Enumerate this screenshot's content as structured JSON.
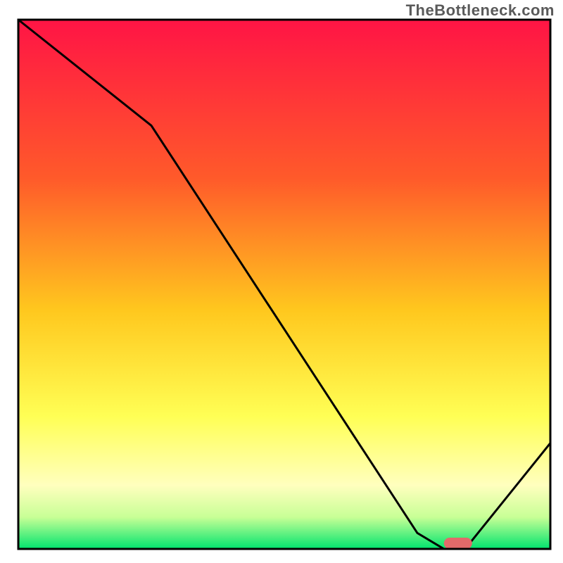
{
  "watermark": "TheBottleneck.com",
  "chart_data": {
    "type": "line",
    "title": "",
    "xlabel": "",
    "ylabel": "",
    "xlim": [
      0,
      100
    ],
    "ylim": [
      0,
      100
    ],
    "x": [
      0,
      25,
      75,
      80,
      84,
      100
    ],
    "values": [
      100,
      80,
      3,
      0,
      0,
      20
    ],
    "optimal_band": {
      "x_start": 80,
      "x_end": 84,
      "value": 0
    },
    "gradient_stops": [
      {
        "offset": 0.0,
        "color": "#ff1445"
      },
      {
        "offset": 0.3,
        "color": "#ff5a2a"
      },
      {
        "offset": 0.55,
        "color": "#ffc81e"
      },
      {
        "offset": 0.75,
        "color": "#ffff55"
      },
      {
        "offset": 0.88,
        "color": "#ffffbe"
      },
      {
        "offset": 0.94,
        "color": "#c8ff96"
      },
      {
        "offset": 1.0,
        "color": "#00e46e"
      }
    ],
    "marker": {
      "color": "#e26a6a",
      "x_start": 80,
      "x_end": 84,
      "y": 0
    },
    "frame": {
      "stroke": "#000000",
      "width": 3
    }
  }
}
